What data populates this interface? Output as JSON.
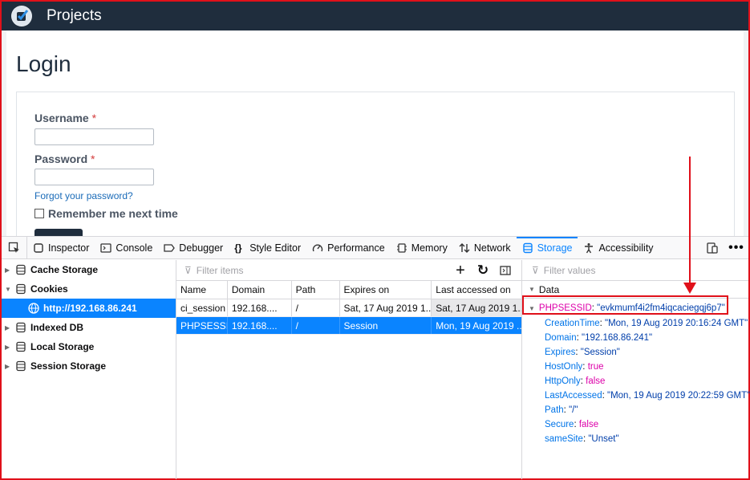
{
  "app": {
    "title": "Projects"
  },
  "login": {
    "title": "Login",
    "username_label": "Username",
    "password_label": "Password",
    "required_mark": "*",
    "forgot": "Forgot your password?",
    "remember": "Remember me next time"
  },
  "devtools": {
    "tabs": [
      {
        "label": "Inspector",
        "icon": "inspector-icon"
      },
      {
        "label": "Console",
        "icon": "console-icon"
      },
      {
        "label": "Debugger",
        "icon": "debugger-icon"
      },
      {
        "label": "Style Editor",
        "icon": "style-editor-icon"
      },
      {
        "label": "Performance",
        "icon": "performance-icon"
      },
      {
        "label": "Memory",
        "icon": "memory-icon"
      },
      {
        "label": "Network",
        "icon": "network-icon"
      },
      {
        "label": "Storage",
        "icon": "storage-icon",
        "active": true
      },
      {
        "label": "Accessibility",
        "icon": "accessibility-icon"
      }
    ],
    "tree": {
      "cache": "Cache Storage",
      "cookies": "Cookies",
      "cookie_host": "http://192.168.86.241",
      "indexeddb": "Indexed DB",
      "local": "Local Storage",
      "session": "Session Storage"
    },
    "filter_placeholder": "Filter items",
    "columns": {
      "name": "Name",
      "domain": "Domain",
      "path": "Path",
      "expires": "Expires on",
      "accessed": "Last accessed on"
    },
    "rows": [
      {
        "name": "ci_session",
        "domain": "192.168....",
        "path": "/",
        "expires": "Sat, 17 Aug 2019 1...",
        "accessed": "Sat, 17 Aug 2019 1..."
      },
      {
        "name": "PHPSESSID",
        "domain": "192.168....",
        "path": "/",
        "expires": "Session",
        "accessed": "Mon, 19 Aug 2019 ..."
      }
    ],
    "side": {
      "filter_placeholder": "Filter values",
      "data_label": "Data",
      "root_key": "PHPSESSID",
      "root_val": "\"evkmumf4i2fm4iqcaciegqj6p7\"",
      "props": [
        {
          "k": "CreationTime",
          "v": "\"Mon, 19 Aug 2019 20:16:24 GMT\"",
          "t": "s"
        },
        {
          "k": "Domain",
          "v": "\"192.168.86.241\"",
          "t": "s"
        },
        {
          "k": "Expires",
          "v": "\"Session\"",
          "t": "s"
        },
        {
          "k": "HostOnly",
          "v": "true",
          "t": "b"
        },
        {
          "k": "HttpOnly",
          "v": "false",
          "t": "b"
        },
        {
          "k": "LastAccessed",
          "v": "\"Mon, 19 Aug 2019 20:22:59 GMT\"",
          "t": "s"
        },
        {
          "k": "Path",
          "v": "\"/\"",
          "t": "s"
        },
        {
          "k": "Secure",
          "v": "false",
          "t": "b"
        },
        {
          "k": "sameSite",
          "v": "\"Unset\"",
          "t": "s"
        }
      ]
    }
  },
  "colors": {
    "accent": "#0a84ff",
    "header": "#1f2d3d",
    "annotation": "#e0101a"
  }
}
